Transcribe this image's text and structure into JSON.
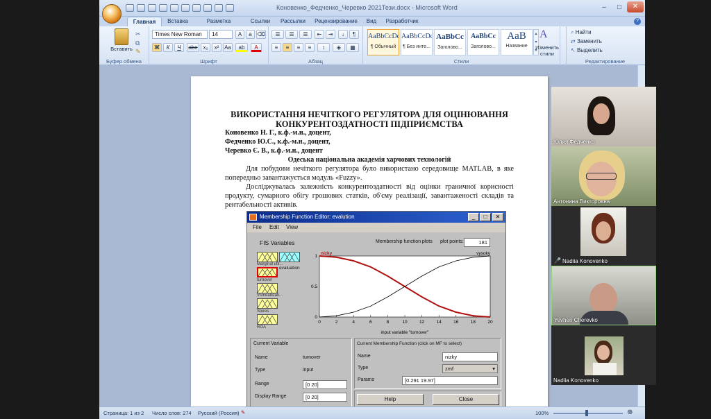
{
  "word": {
    "title": "Коновенко_Федченко_Черевко 2021Тези.docx  -  Microsoft Word",
    "tabs": [
      "Главная",
      "Вставка",
      "Разметка страницы",
      "Ссылки",
      "Рассылки",
      "Рецензирование",
      "Вид",
      "Разработчик"
    ],
    "ribbon": {
      "clipboard_label": "Буфер обмена",
      "paste_label": "Вставить",
      "font_label": "Шрифт",
      "font_name": "Times New Roman",
      "font_size": "14",
      "paragraph_label": "Абзац",
      "styles_label": "Стили",
      "editing_label": "Редактирование",
      "styles": [
        {
          "preview": "AaBbCcDc",
          "name": "¶ Обычный"
        },
        {
          "preview": "AaBbCcDc",
          "name": "¶ Без инте..."
        },
        {
          "preview": "AaBbCc",
          "name": "Заголово..."
        },
        {
          "preview": "AaBbCc",
          "name": "Заголово..."
        },
        {
          "preview": "AaB",
          "name": "Название"
        }
      ],
      "change_styles": "Изменить стили",
      "find": "Найти",
      "replace": "Заменить",
      "select": "Выделить"
    },
    "status": {
      "page": "Страница: 1 из 2",
      "words": "Число слов: 274",
      "language": "Русский (Россия)",
      "zoom": "100%"
    }
  },
  "document": {
    "title_line1": "ВИКОРИСТАННЯ  НЕЧІТКОГО РЕГУЛЯТОРА ДЛЯ ОЦІНЮВАННЯ",
    "title_line2": "КОНКУРЕНТОЗДАТНОСТІ ПІДПРИЄМСТВА",
    "author1": "Коновенко Н. Г., к.ф.-м.н., доцент,",
    "author2": "Федченко Ю.С., к.ф.-м.н., доцент,",
    "author3": "Черевко  Є. В.,  к.ф.-м.н., доцент",
    "affiliation": "Одеська національна академія харчових технологій",
    "para1": "Для побудови нечіткого регулятора було використано середовище MATLAB, в яке попередньо завантажується модуль «Fuzzy».",
    "para2": "Досліджувалась залежність конкурентоздатності від оцінки граничної корисності продукту, сумарного обігу грошових статків, об'єму реалізації, завантаженості складів та рентабельності активів."
  },
  "matlab": {
    "window_title": "Membership Function Editor: evalution",
    "menu": [
      "File",
      "Edit",
      "View"
    ],
    "fis_title": "FIS Variables",
    "variables": [
      "Marginal util...",
      "turnover",
      "Vsmeallizati...",
      "Stores",
      "ROA"
    ],
    "output_var": "evaluation",
    "plot_title": "Membership function plots",
    "plot_points_label": "plot points:",
    "plot_points": "181",
    "mf_labels": {
      "left": "nizky",
      "right": "vysoky"
    },
    "yticks": [
      "1",
      "0.5",
      "0"
    ],
    "xaxis_label": "input variable \"turnover\"",
    "current_variable": {
      "title": "Current Variable",
      "name_label": "Name",
      "name": "turnover",
      "type_label": "Type",
      "type": "input",
      "range_label": "Range",
      "range": "[0 20]",
      "display_range_label": "Display Range",
      "display_range": "[0 20]"
    },
    "current_mf": {
      "title": "Current Membership Function (click on MF to select)",
      "name_label": "Name",
      "name": "nizky",
      "type_label": "Type",
      "type": "zmf",
      "params_label": "Params",
      "params": "[0.291 19.97]"
    },
    "help": "Help",
    "close": "Close"
  },
  "chart_data": {
    "type": "line",
    "x": [
      0,
      2,
      4,
      6,
      8,
      10,
      12,
      14,
      16,
      18,
      20
    ],
    "xlim": [
      0,
      20
    ],
    "ylim": [
      0,
      1
    ],
    "xticks": [
      "0",
      "2",
      "4",
      "6",
      "8",
      "10",
      "12",
      "14",
      "16",
      "18",
      "20"
    ],
    "xlabel": "input variable \"turnover\"",
    "series": [
      {
        "name": "nizky",
        "values": [
          1.0,
          0.98,
          0.92,
          0.82,
          0.67,
          0.5,
          0.33,
          0.18,
          0.08,
          0.02,
          0.0
        ],
        "color": "#b01010"
      },
      {
        "name": "vysoky",
        "values": [
          0.0,
          0.02,
          0.08,
          0.18,
          0.33,
          0.5,
          0.67,
          0.82,
          0.92,
          0.98,
          1.0
        ],
        "color": "#000000"
      }
    ]
  },
  "participants": [
    "Юлия Федченко",
    "Антонина Викторовна",
    "Nadiia Konovenko",
    "Yevhen Cherevko",
    "Nadiia Konovenko"
  ]
}
